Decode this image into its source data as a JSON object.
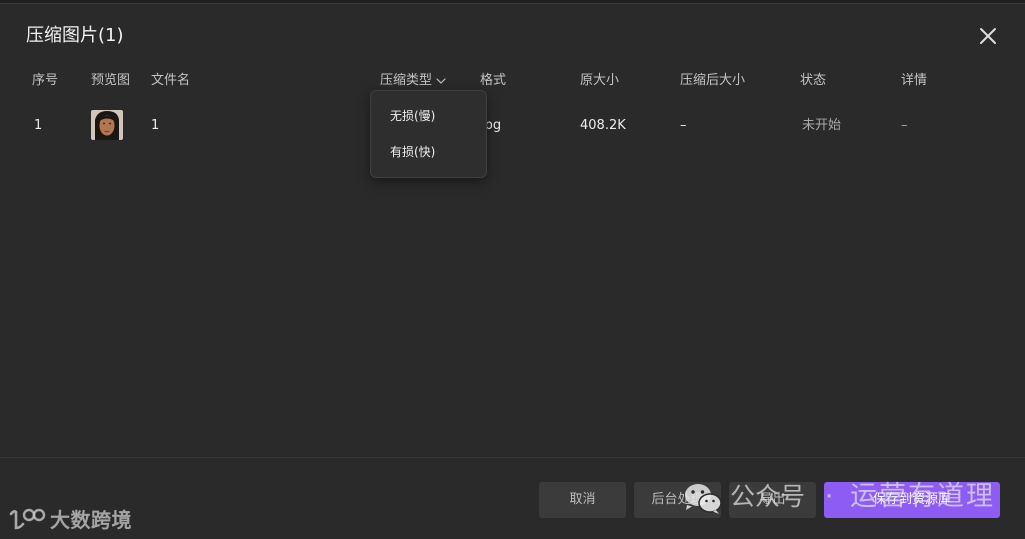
{
  "dialog": {
    "title": "压缩图片(1)",
    "close_icon": "close-icon"
  },
  "table": {
    "columns": [
      "序号",
      "预览图",
      "文件名",
      "压缩类型",
      "格式",
      "原大小",
      "压缩后大小",
      "状态",
      "详情"
    ],
    "sort_icon": "chevron-down-icon",
    "rows": [
      {
        "index": "1",
        "filename": "1",
        "format": "jpg",
        "original_size": "408.2K",
        "compressed_size": "–",
        "status": "未开始",
        "details": "–"
      }
    ]
  },
  "compress_type_dropdown": {
    "expanded": true,
    "options": [
      "无损(慢)",
      "有损(快)"
    ]
  },
  "footer": {
    "cancel_label": "取消",
    "background_label": "后台处理",
    "export_label": "导出",
    "save_label": "保存到资源库"
  },
  "watermarks": {
    "wechat_icon": "wechat-icon",
    "official_account": "公众号",
    "separator": "·",
    "account_name": "运营有道理",
    "logo_icon": "dashukuajing-logo-icon",
    "logo_text": "大数跨境"
  },
  "colors": {
    "background": "#2a2a2a",
    "accent": "#8c5cf5",
    "secondary_button": "#3b3b3b"
  }
}
